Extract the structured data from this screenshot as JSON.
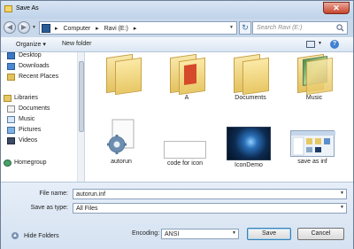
{
  "window": {
    "title": "Save As",
    "close_glyph": "✕"
  },
  "nav": {
    "back_glyph": "◀",
    "forward_glyph": "▶",
    "breadcrumb": [
      "▸",
      "Computer",
      "▸",
      "Ravi (E:)",
      "▸"
    ],
    "refresh_glyph": "↻",
    "search_placeholder": "Search Ravi (E:)"
  },
  "toolbar": {
    "organize_label": "Organize ▾",
    "new_folder_label": "New folder",
    "help_glyph": "?"
  },
  "sidebar": {
    "items": [
      {
        "label": "Desktop",
        "icon": "desktop-icon"
      },
      {
        "label": "Downloads",
        "icon": "downloads-icon"
      },
      {
        "label": "Recent Places",
        "icon": "recent-places-icon"
      },
      {
        "label": "Libraries",
        "icon": "libraries-icon"
      },
      {
        "label": "Documents",
        "icon": "documents-icon"
      },
      {
        "label": "Music",
        "icon": "music-icon"
      },
      {
        "label": "Pictures",
        "icon": "pictures-icon"
      },
      {
        "label": "Videos",
        "icon": "videos-icon"
      },
      {
        "label": "Homegroup",
        "icon": "homegroup-icon"
      }
    ]
  },
  "files": [
    {
      "label": "",
      "kind": "folder"
    },
    {
      "label": "A",
      "kind": "folder"
    },
    {
      "label": "Documents",
      "kind": "folder"
    },
    {
      "label": "Music",
      "kind": "folder"
    },
    {
      "label": "autorun",
      "kind": "settings-file"
    },
    {
      "label": "code for icon",
      "kind": "text-file"
    },
    {
      "label": "IconDemo",
      "kind": "image-file"
    },
    {
      "label": "save as inf",
      "kind": "image-file"
    }
  ],
  "form": {
    "file_name_label": "File name:",
    "file_name_value": "autorun.inf",
    "save_as_type_label": "Save as type:",
    "save_as_type_value": "All Files",
    "hide_folders_label": "Hide Folders",
    "encoding_label": "Encoding:",
    "encoding_value": "ANSI",
    "save_label": "Save",
    "cancel_label": "Cancel"
  }
}
